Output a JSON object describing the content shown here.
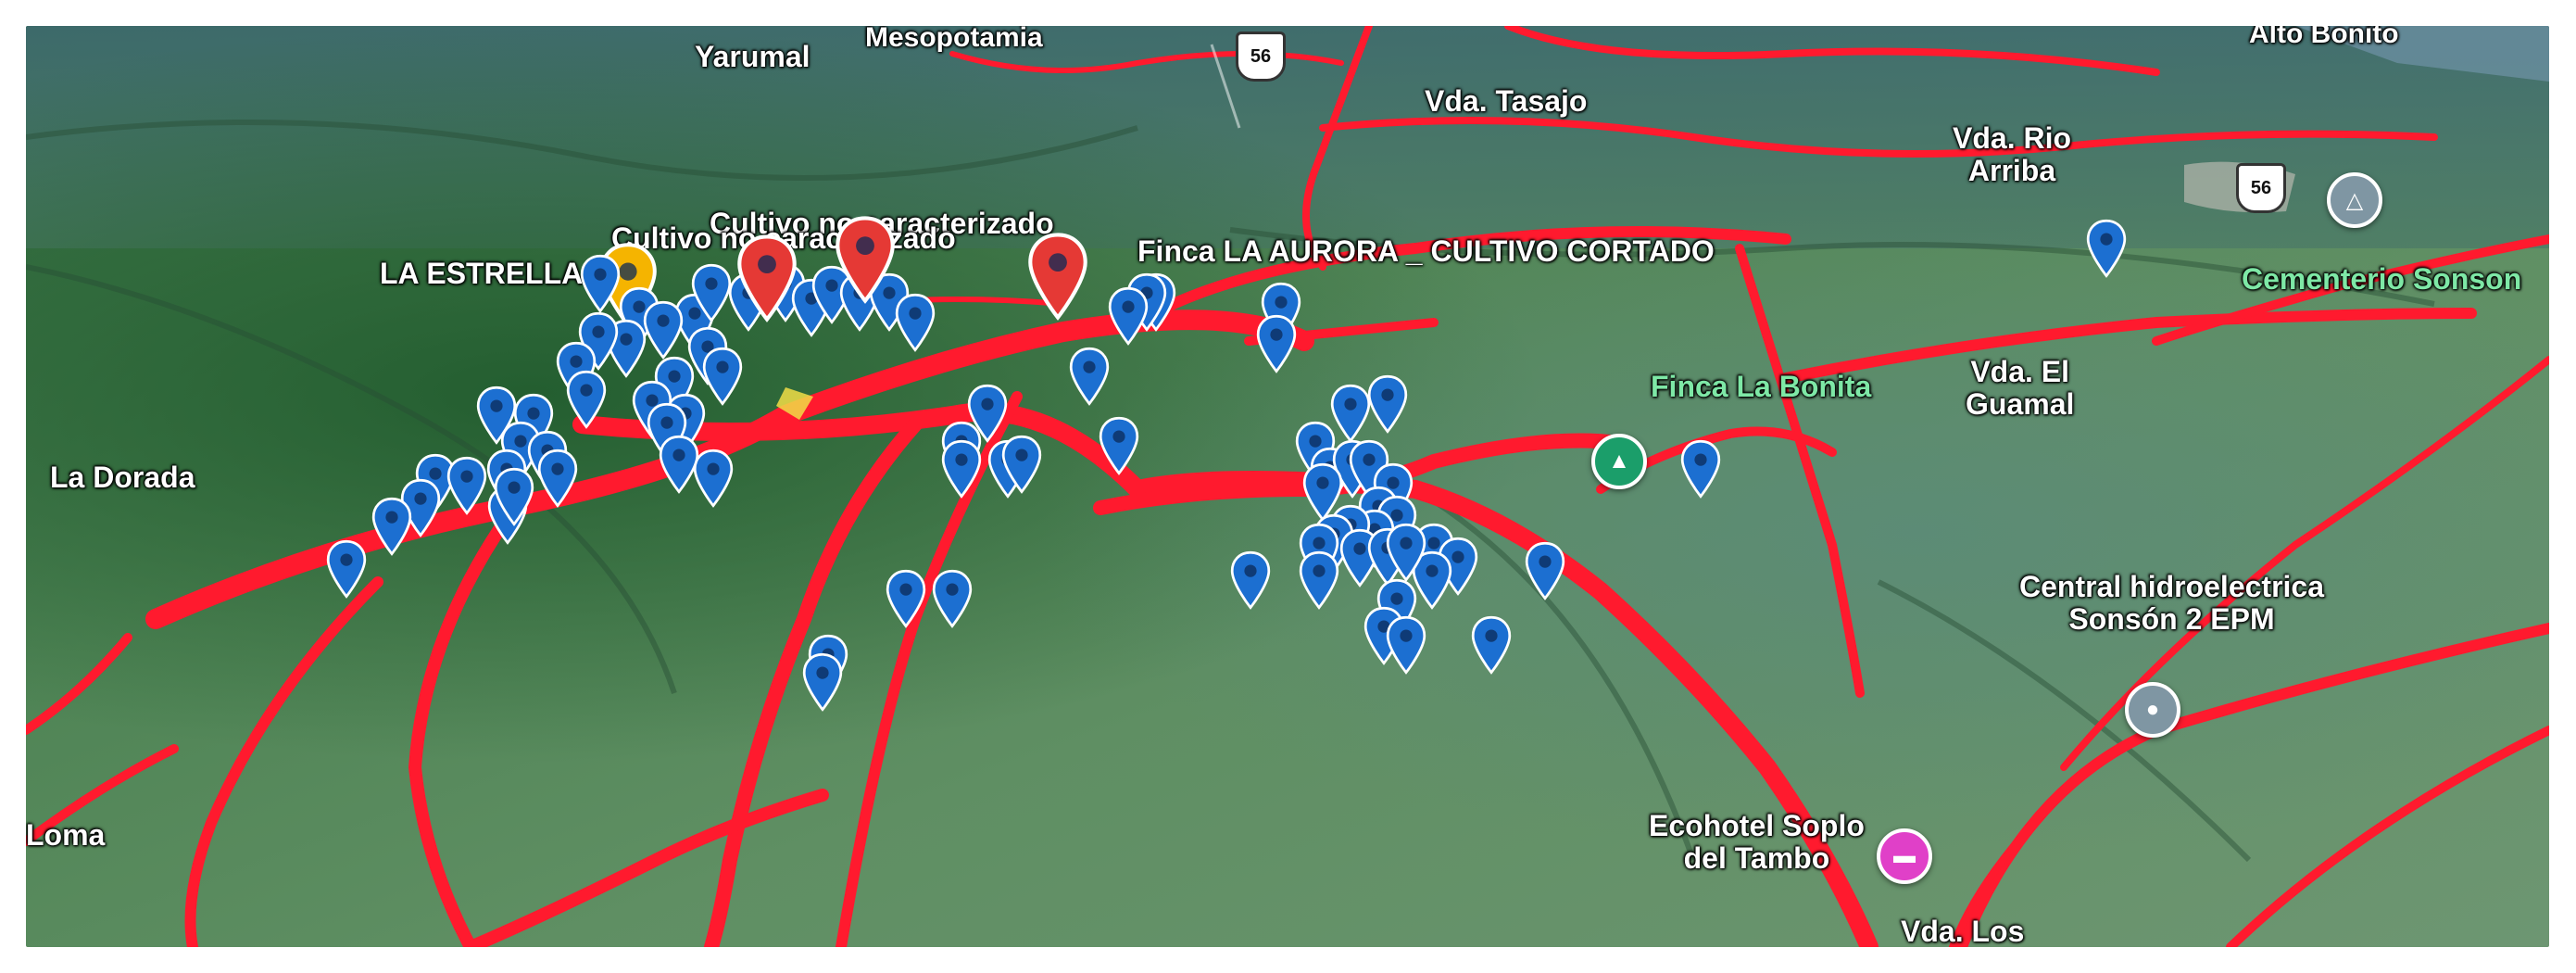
{
  "map": {
    "labels": {
      "yarumal": "Yarumal",
      "mesopotamia": "Mesopotamia",
      "alto_bonito": "Alto Bonito",
      "vda_tasajo": "Vda. Tasajo",
      "vda_rio_arriba": "Vda. Rio\nArriba",
      "cultivo_1": "Cultivo no caracterizado",
      "cultivo_2": "Cultivo no caracterizado",
      "la_estrella": "LA ESTRELLA",
      "finca_aurora": "Finca LA AURORA _ CULTIVO CORTADO",
      "cementerio": "Cementerio Sonson",
      "finca_bonita": "Finca La Bonita",
      "vda_el_guamal": "Vda. El\nGuamal",
      "la_dorada": "La Dorada",
      "central_hidro": "Central hidroelectrica\nSonsón 2 EPM",
      "loma": "Loma",
      "ecohotel": "Ecohotel Soplo\ndel Tambo",
      "vda_los": "Vda. Los"
    },
    "road_shields": {
      "shield_1": "56",
      "shield_2": "56"
    },
    "colors": {
      "blue_pin": "#1c6fd1",
      "red_pin": "#e53935",
      "yellow_pin": "#f5b400",
      "boundary_line": "#ff1a2e",
      "park_poi": "#1b9e6a",
      "hotel_poi": "#e040c8",
      "gray_poi": "#7f96a3"
    },
    "icons": {
      "park": "tree-icon",
      "hotel": "bed-icon",
      "monument": "monument-icon",
      "place": "place-icon"
    },
    "marker_counts": {
      "blue": 82,
      "red": 3,
      "yellow": 1
    }
  }
}
